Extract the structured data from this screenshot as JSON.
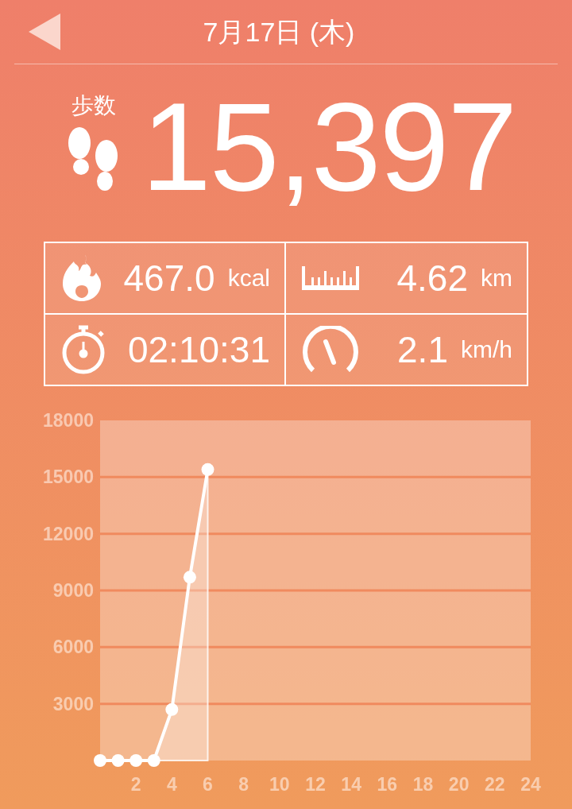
{
  "header": {
    "title": "7月17日 (木)"
  },
  "steps": {
    "label": "歩数",
    "value": "15,397"
  },
  "stats": [
    {
      "kind": "calories",
      "value": "467.0",
      "unit": "kcal"
    },
    {
      "kind": "distance",
      "value": "4.62",
      "unit": "km"
    },
    {
      "kind": "time",
      "value": "02:10:31"
    },
    {
      "kind": "speed",
      "value": "2.1",
      "unit": "km/h"
    }
  ],
  "chart": {
    "chart_data": {
      "type": "area",
      "x": [
        0,
        1,
        2,
        3,
        4,
        5,
        6
      ],
      "series": [
        {
          "color": "#ffffff",
          "values": [
            0,
            0,
            0,
            0,
            2700,
            9700,
            15400
          ]
        }
      ],
      "grid": true,
      "xlim": [
        0,
        24
      ],
      "ylim": [
        0,
        18000
      ],
      "xticks": [
        2,
        4,
        6,
        8,
        10,
        12,
        14,
        16,
        18,
        20,
        22,
        24
      ],
      "yticks": [
        3000,
        6000,
        9000,
        12000,
        15000,
        18000
      ]
    }
  }
}
